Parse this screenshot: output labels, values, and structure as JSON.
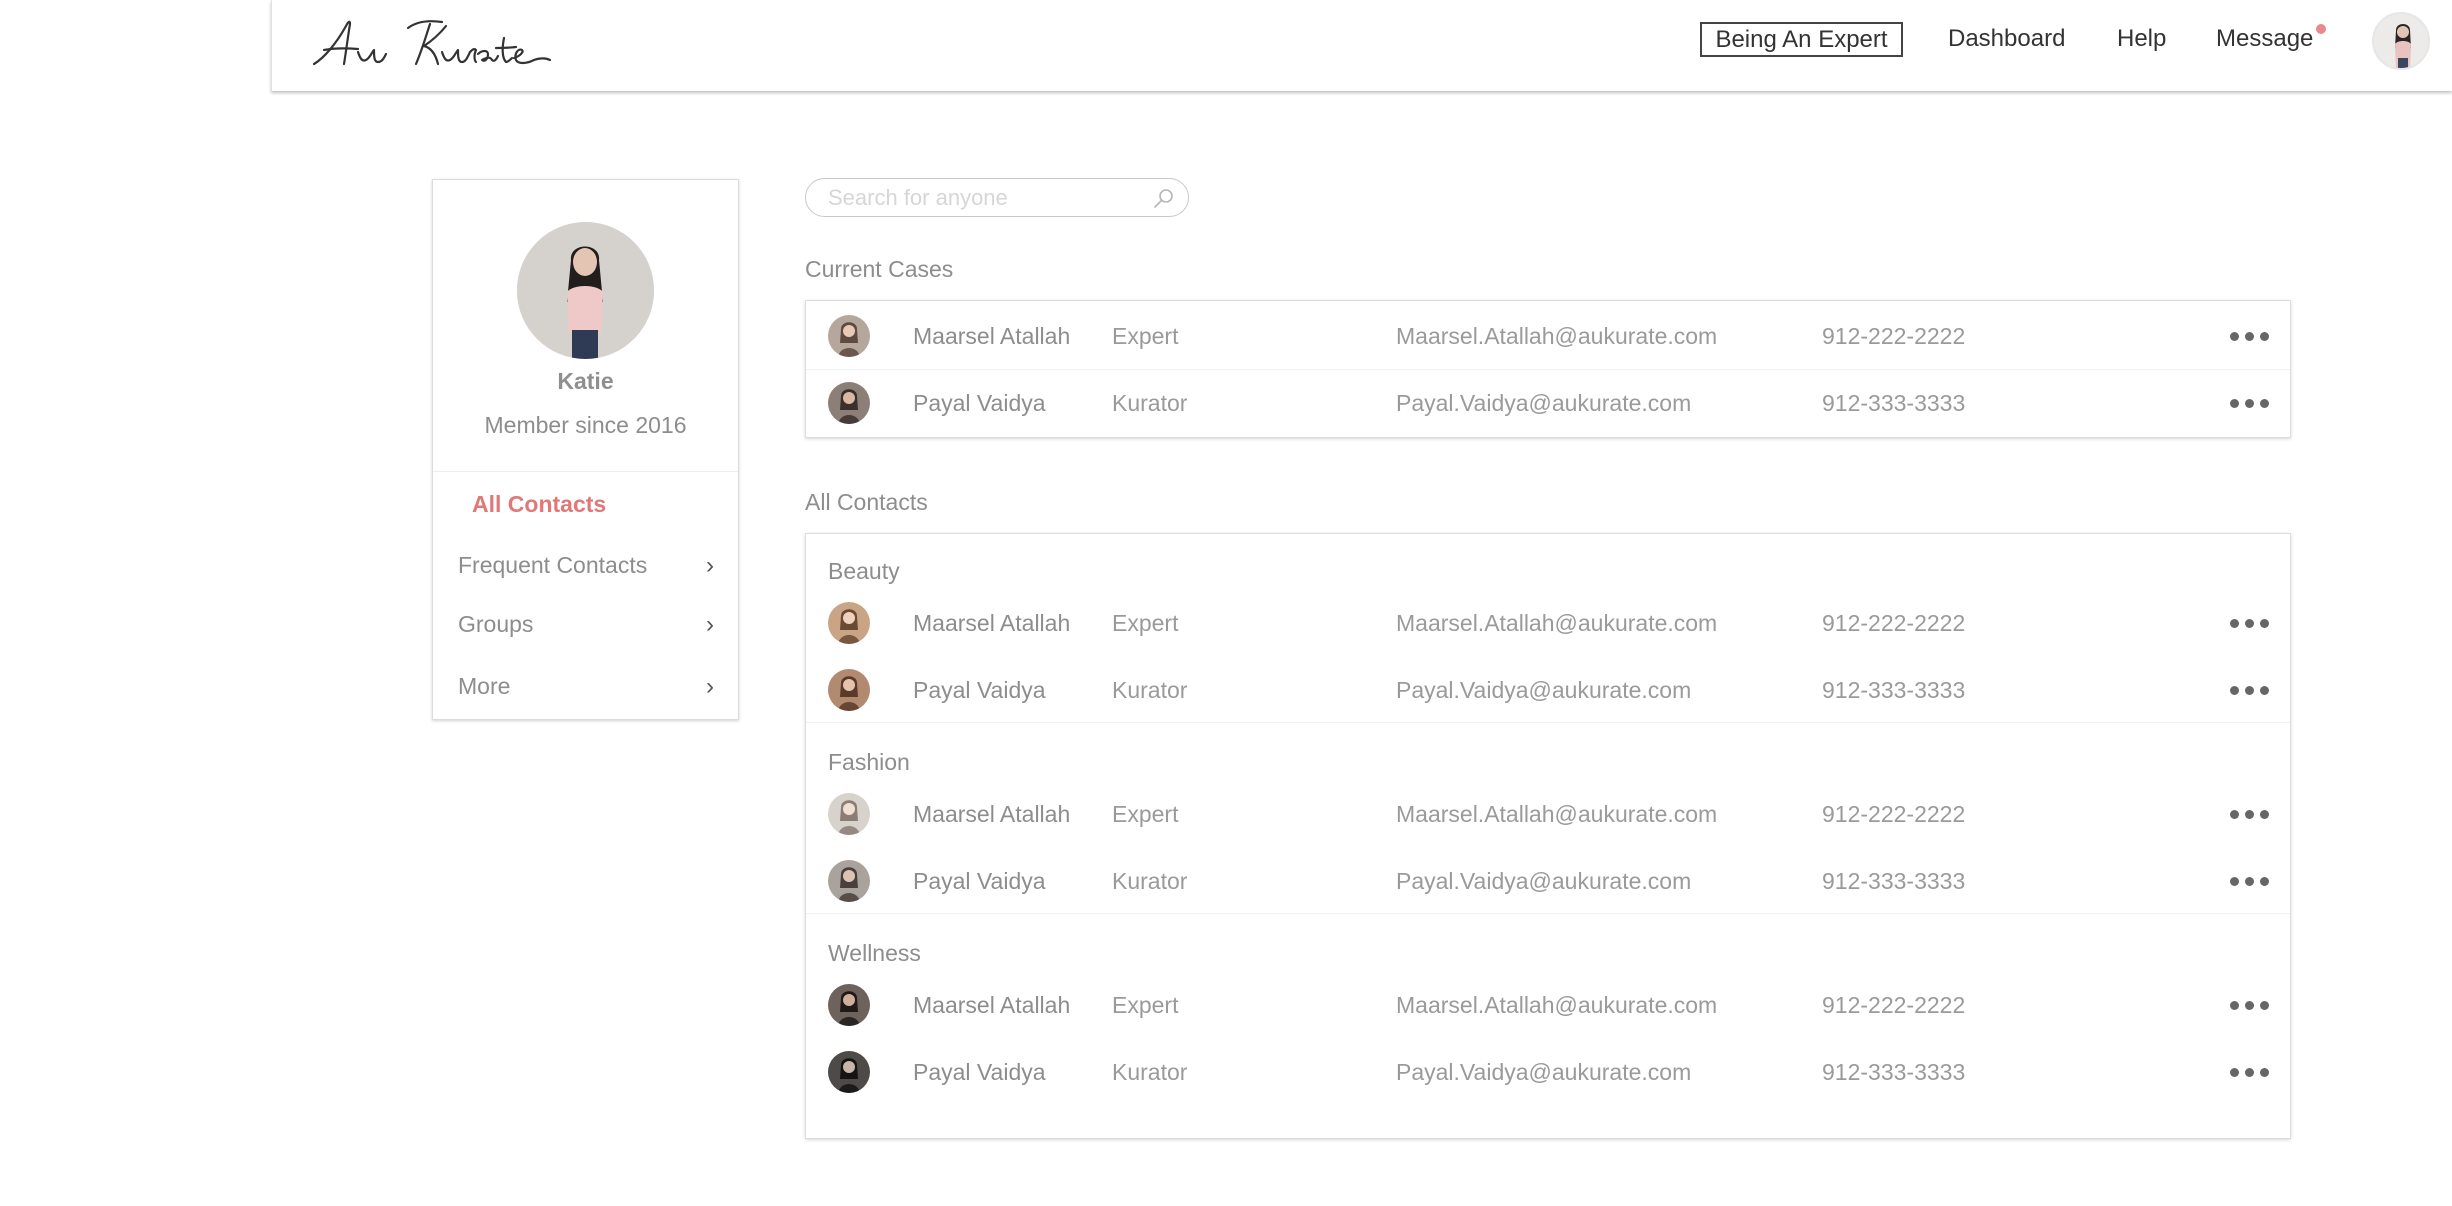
{
  "header": {
    "logo_text": "Au Kurate",
    "cta": "Being An Expert",
    "nav": {
      "dashboard": "Dashboard",
      "help": "Help",
      "message": "Message"
    },
    "message_dot_color": "#e88a8a"
  },
  "profile": {
    "name": "Katie",
    "member_since": "Member since 2016"
  },
  "menu": {
    "all_contacts": "All Contacts",
    "frequent_contacts": "Frequent Contacts",
    "groups": "Groups",
    "more": "More",
    "chevron": "›"
  },
  "search": {
    "placeholder": "Search for anyone"
  },
  "current_cases": {
    "title": "Current Cases",
    "rows": [
      {
        "name": "Maarsel Atallah",
        "role": "Expert",
        "email": "Maarsel.Atallah@aukurate.com",
        "phone": "912-222-2222"
      },
      {
        "name": "Payal Vaidya",
        "role": "Kurator",
        "email": "Payal.Vaidya@aukurate.com",
        "phone": "912-333-3333"
      }
    ]
  },
  "all_contacts": {
    "title": "All Contacts",
    "groups": [
      {
        "label": "Beauty",
        "rows": [
          {
            "name": "Maarsel Atallah",
            "role": "Expert",
            "email": "Maarsel.Atallah@aukurate.com",
            "phone": "912-222-2222"
          },
          {
            "name": "Payal Vaidya",
            "role": "Kurator",
            "email": "Payal.Vaidya@aukurate.com",
            "phone": "912-333-3333"
          }
        ]
      },
      {
        "label": "Fashion",
        "rows": [
          {
            "name": "Maarsel Atallah",
            "role": "Expert",
            "email": "Maarsel.Atallah@aukurate.com",
            "phone": "912-222-2222"
          },
          {
            "name": "Payal Vaidya",
            "role": "Kurator",
            "email": "Payal.Vaidya@aukurate.com",
            "phone": "912-333-3333"
          }
        ]
      },
      {
        "label": "Wellness",
        "rows": [
          {
            "name": "Maarsel Atallah",
            "role": "Expert",
            "email": "Maarsel.Atallah@aukurate.com",
            "phone": "912-222-2222"
          },
          {
            "name": "Payal Vaidya",
            "role": "Kurator",
            "email": "Payal.Vaidya@aukurate.com",
            "phone": "912-333-3333"
          }
        ]
      }
    ]
  },
  "colors": {
    "accent": "#e27777",
    "text": "#8d8d8d",
    "border": "#dcdcdc"
  }
}
